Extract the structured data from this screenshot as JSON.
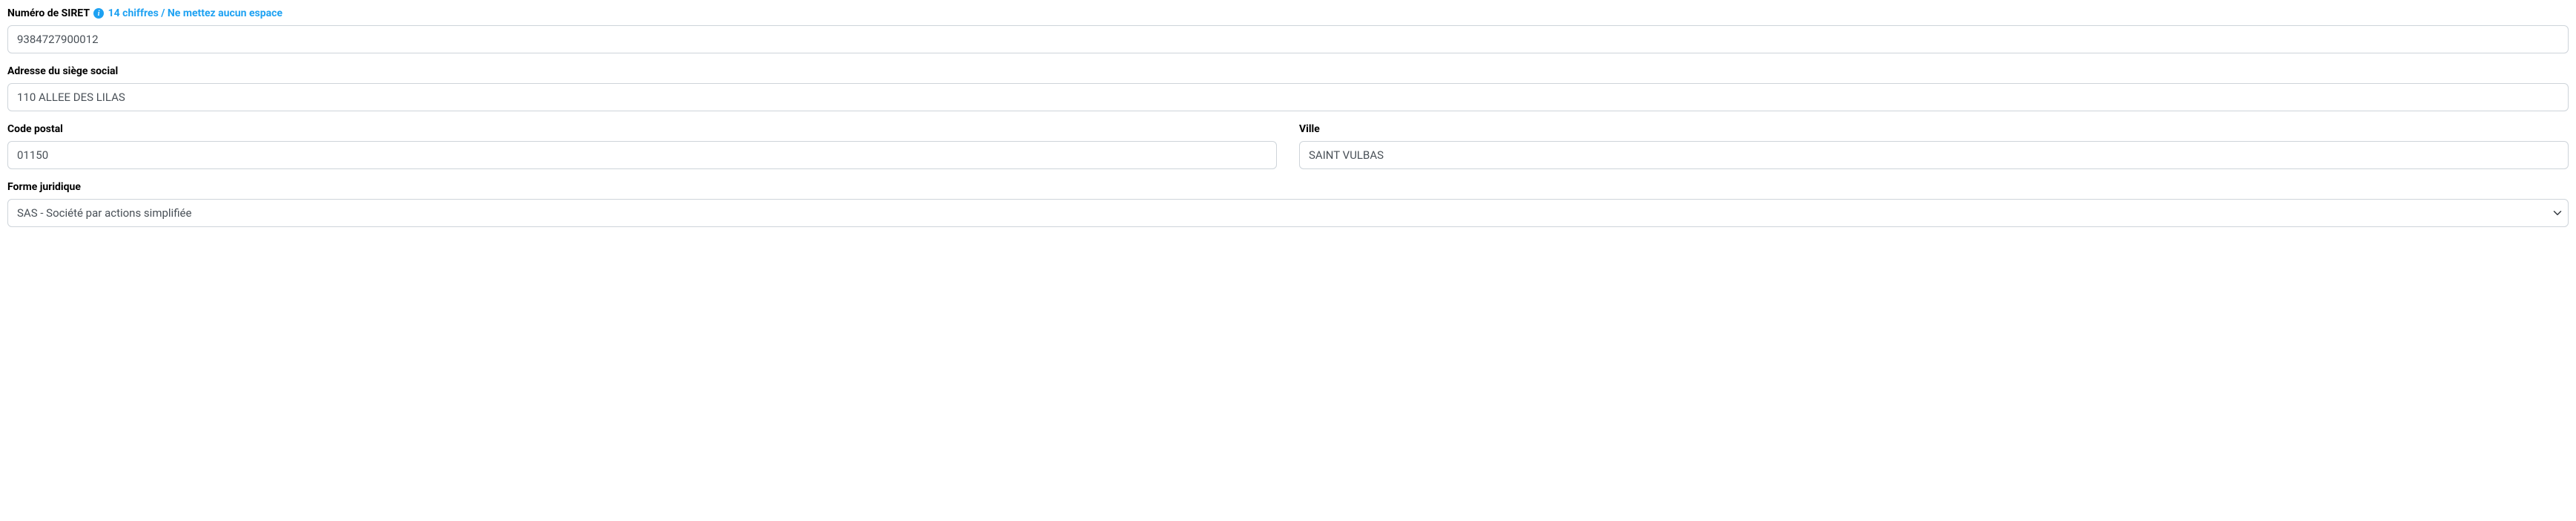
{
  "siret": {
    "label": "Numéro de SIRET",
    "hint": "14 chiffres / Ne mettez aucun espace",
    "info_icon": "i",
    "value": "9384727900012"
  },
  "address": {
    "label": "Adresse du siège social",
    "value": "110 ALLEE DES LILAS"
  },
  "postal": {
    "label": "Code postal",
    "value": "01150"
  },
  "city": {
    "label": "Ville",
    "value": "SAINT VULBAS"
  },
  "legal_form": {
    "label": "Forme juridique",
    "selected": "SAS - Société par actions simplifiée"
  }
}
